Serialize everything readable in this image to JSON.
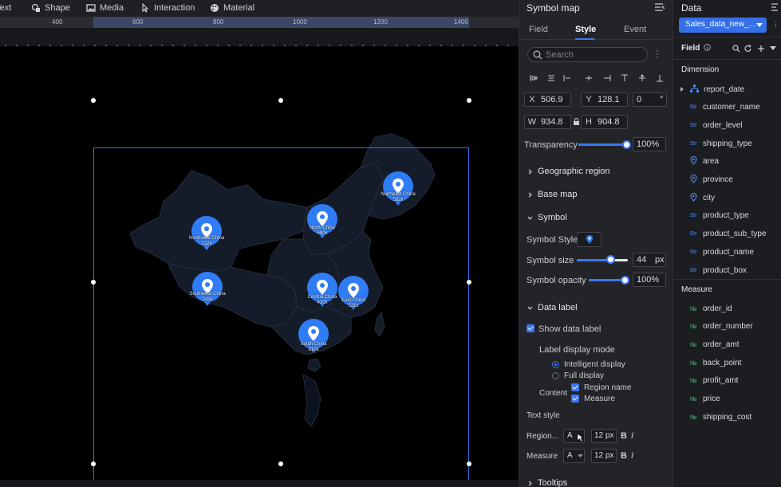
{
  "toolbar": {
    "items": [
      {
        "label": "Text",
        "icon": "text-icon"
      },
      {
        "label": "Shape",
        "icon": "shape-icon"
      },
      {
        "label": "Media",
        "icon": "media-icon"
      },
      {
        "label": "Interaction",
        "icon": "interaction-icon"
      },
      {
        "label": "Material",
        "icon": "material-icon"
      }
    ]
  },
  "ruler": {
    "ticks": [
      "400",
      "600",
      "800",
      "1000",
      "1200",
      "1400"
    ]
  },
  "map": {
    "pins": [
      {
        "region": "Northwest China",
        "value": "232k"
      },
      {
        "region": "North China",
        "value": "680k"
      },
      {
        "region": "Northeast China",
        "value": "592k"
      },
      {
        "region": "Southwest China",
        "value": "243k"
      },
      {
        "region": "Central China",
        "value": "410k"
      },
      {
        "region": "East China",
        "value": "531k"
      },
      {
        "region": "South China",
        "value": "810k"
      }
    ],
    "pin_color": "#2f7cf6"
  },
  "style_panel": {
    "title": "Symbol map",
    "tabs": [
      "Field",
      "Style",
      "Event"
    ],
    "active_tab": "Style",
    "search_placeholder": "Search",
    "x_label": "X",
    "x_value": "506.9",
    "y_label": "Y",
    "y_value": "128.1",
    "rotation_value": "0",
    "rotation_unit": "°",
    "w_label": "W",
    "w_value": "934.8",
    "h_label": "H",
    "h_value": "904.8",
    "transparency_label": "Transparency",
    "transparency_value": "100%",
    "sections": {
      "geographic_region": "Geographic region",
      "base_map": "Base map",
      "symbol": "Symbol",
      "data_label": "Data label",
      "tooltips": "Tooltips"
    },
    "symbol_style_label": "Symbol Style",
    "symbol_size_label": "Symbol size",
    "symbol_size_value": "44",
    "symbol_size_unit": "px",
    "symbol_opacity_label": "Symbol opacity",
    "symbol_opacity_value": "100%",
    "show_data_label": "Show data label",
    "label_display_mode": "Label display mode",
    "intelligent_display": "Intelligent display",
    "full_display": "Full display",
    "content_label": "Content",
    "region_name": "Region name",
    "measure": "Measure",
    "text_style": "Text style",
    "region_row_label": "Region...",
    "measure_row_label": "Measure",
    "font_btn": "A",
    "font_size_value": "12",
    "font_size_unit": "px",
    "bold": "B",
    "italic": "I",
    "accent": "#3b78f5"
  },
  "data_panel": {
    "title": "Data",
    "dataset": "Sales_data_new_...",
    "field_label": "Field",
    "dimension_label": "Dimension",
    "dimensions": [
      {
        "name": "report_date",
        "type": "date"
      },
      {
        "name": "customer_name",
        "type": "str"
      },
      {
        "name": "order_level",
        "type": "str"
      },
      {
        "name": "shipping_type",
        "type": "str"
      },
      {
        "name": "area",
        "type": "geo"
      },
      {
        "name": "province",
        "type": "geo"
      },
      {
        "name": "city",
        "type": "geo"
      },
      {
        "name": "product_type",
        "type": "str"
      },
      {
        "name": "product_sub_type",
        "type": "str"
      },
      {
        "name": "product_name",
        "type": "str"
      },
      {
        "name": "product_box",
        "type": "str"
      }
    ],
    "measure_label": "Measure",
    "measures": [
      "order_id",
      "order_number",
      "order_amt",
      "back_point",
      "profit_amt",
      "price",
      "shipping_cost"
    ],
    "str_tag": "Str",
    "num_tag": "№"
  }
}
